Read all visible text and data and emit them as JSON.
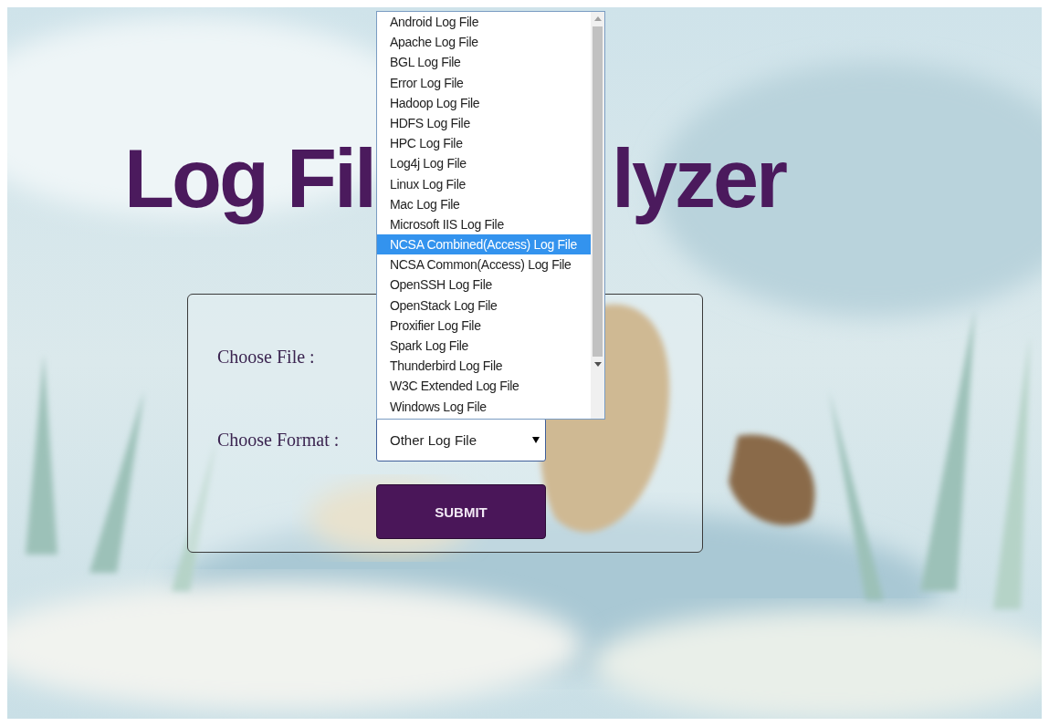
{
  "title_parts": [
    "Log Fil",
    "lyzer"
  ],
  "form": {
    "file_label": "Choose File :",
    "format_label": "Choose Format :",
    "format_value": "Other Log File",
    "submit": "SUBMIT"
  },
  "format_options": [
    {
      "label": "Android Log File",
      "selected": false
    },
    {
      "label": "Apache Log File",
      "selected": false
    },
    {
      "label": "BGL Log File",
      "selected": false
    },
    {
      "label": "Error Log File",
      "selected": false
    },
    {
      "label": "Hadoop Log File",
      "selected": false
    },
    {
      "label": "HDFS Log File",
      "selected": false
    },
    {
      "label": "HPC Log File",
      "selected": false
    },
    {
      "label": "Log4j Log File",
      "selected": false
    },
    {
      "label": "Linux Log File",
      "selected": false
    },
    {
      "label": "Mac Log File",
      "selected": false
    },
    {
      "label": "Microsoft IIS Log File",
      "selected": false
    },
    {
      "label": "NCSA Combined(Access) Log File",
      "selected": true
    },
    {
      "label": "NCSA Common(Access) Log File",
      "selected": false
    },
    {
      "label": "OpenSSH Log File",
      "selected": false
    },
    {
      "label": "OpenStack Log File",
      "selected": false
    },
    {
      "label": "Proxifier Log File",
      "selected": false
    },
    {
      "label": "Spark Log File",
      "selected": false
    },
    {
      "label": "Thunderbird Log File",
      "selected": false
    },
    {
      "label": "W3C Extended Log File",
      "selected": false
    },
    {
      "label": "Windows Log File",
      "selected": false
    }
  ]
}
